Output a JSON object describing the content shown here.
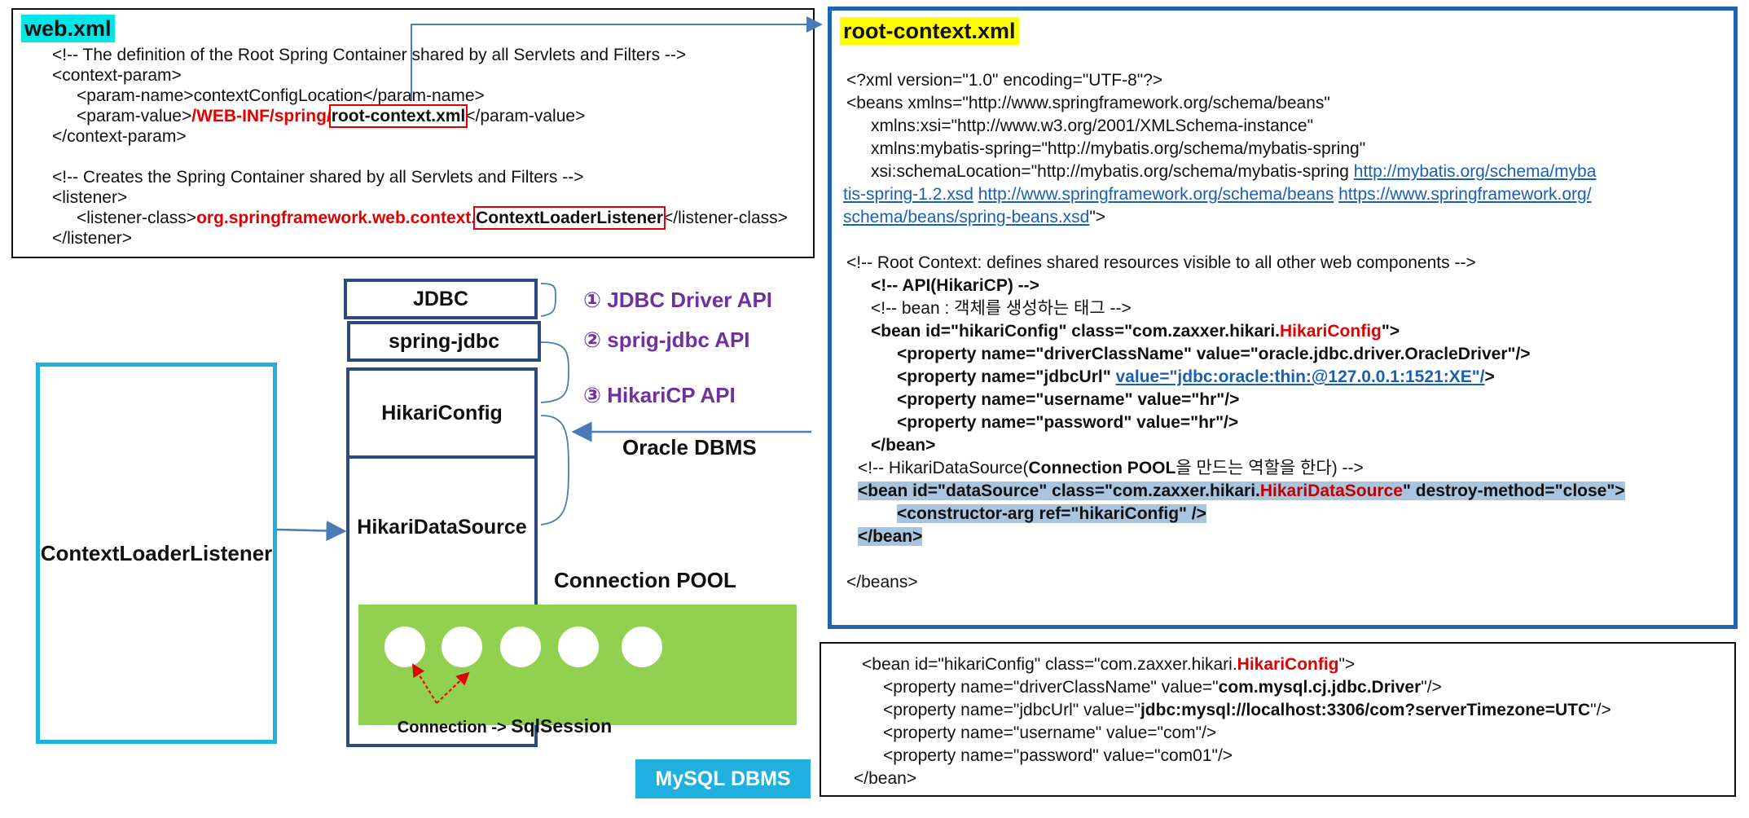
{
  "web_xml": {
    "title": "web.xml",
    "line1": "<!-- The definition of the Root Spring Container shared by all Servlets and Filters -->",
    "line2": "<context-param>",
    "line3a": "<param-name>",
    "line3b": "contextConfigLocation",
    "line3c": "</param-name>",
    "line4a": "<param-value>",
    "line4b": "/WEB-INF/spring/",
    "line4c": "root-context.xml",
    "line4d": "</param-value>",
    "line5": "</context-param>",
    "line6": "<!-- Creates the Spring Container shared by all Servlets and Filters -->",
    "line7": "<listener>",
    "line8a": "<listener-class>",
    "line8b": "org.springframework.web.context.",
    "line8c": "ContextLoaderListener",
    "line8d": "</listener-class>",
    "line9": "</listener>"
  },
  "root_context": {
    "title": "root-context.xml",
    "l1": "<?xml version=\"1.0\" encoding=\"UTF-8\"?>",
    "l2": "<beans xmlns=\"http://www.springframework.org/schema/beans\"",
    "l3": "xmlns:xsi=\"http://www.w3.org/2001/XMLSchema-instance\"",
    "l4": "xmlns:mybatis-spring=\"http://mybatis.org/schema/mybatis-spring\"",
    "l5a": "xsi:schemaLocation=\"http://mybatis.org/schema/mybatis-spring ",
    "l5b": "http://mybatis.org/schema/myba",
    "l6a": "tis-spring-1.2.xsd",
    "l6b": "http://www.springframework.org/schema/beans",
    "l6c": "https://www.springframework.org/",
    "l7a": "schema/beans/spring-beans.xsd",
    "l7b": "\">",
    "l8": "<!-- Root Context: defines shared resources visible to all other web components -->",
    "l9": "<!-- API(HikariCP) -->",
    "l10": "<!-- bean : 객체를 생성하는 태그 -->",
    "l11a": "<bean id=\"hikariConfig\" class=\"com.zaxxer.hikari.",
    "l11b": "HikariConfig",
    "l11c": "\">",
    "l12": "<property name=\"driverClassName\" value=\"oracle.jdbc.driver.OracleDriver\"/>",
    "l13a": "<property name=\"jdbcUrl\" ",
    "l13b": "value=\"jdbc:oracle:thin:@127.0.0.1:1521:XE\"/",
    "l13c": ">",
    "l14": "<property name=\"username\" value=\"hr\"/>",
    "l15": "<property name=\"password\" value=\"hr\"/>",
    "l16": "</bean>",
    "l17a": "<!-- HikariDataSource(",
    "l17b": "Connection POOL",
    "l17c": "을 만드는 역할을 한다) -->",
    "l18a": "<bean id=\"dataSource\" class=\"com.zaxxer.hikari.",
    "l18b": "HikariDataSource",
    "l18c": "\" destroy-method=\"close\">",
    "l19": "<constructor-arg ref=\"hikariConfig\" />",
    "l20": "</bean>",
    "l21": "</beans>"
  },
  "mysql_box": {
    "m1a": "<bean id=\"hikariConfig\" class=\"com.zaxxer.hikari.",
    "m1b": "HikariConfig",
    "m1c": "\">",
    "m2a": "<property name=\"driverClassName\" value=\"",
    "m2b": "com.mysql.cj.jdbc.Driver",
    "m2c": "\"/>",
    "m3a": "<property name=\"jdbcUrl\" value=\"",
    "m3b": "jdbc:mysql://localhost:3306/com?serverTimezone=UTC",
    "m3c": "\"/>",
    "m4": "<property name=\"username\" value=\"com\"/>",
    "m5": "<property name=\"password\" value=\"com01\"/>",
    "m6": "</bean>"
  },
  "diagram": {
    "listener_label": "ContextLoaderListener",
    "jdbc": "JDBC",
    "spring_jdbc": "spring-jdbc",
    "hikari_config": "HikariConfig",
    "hikari_datasource": "HikariDataSource",
    "api1": "① JDBC Driver API",
    "api2": "② sprig-jdbc API",
    "api3": "③ HikariCP API",
    "oracle_label": "Oracle DBMS",
    "pool_label": "Connection POOL",
    "conn_label_a": "Connection -> ",
    "conn_label_b": "SqlSession",
    "mysql_label": "MySQL DBMS"
  },
  "colors": {
    "web_title_bg": "#00e5e5",
    "root_title_bg": "#ffff00",
    "root_border": "#1f63b4",
    "listener_border": "#1fb0e0",
    "stack_border": "#2c4a7a",
    "pool_green": "#92d050",
    "api_purple": "#7030a0",
    "mysql_bg": "#1fb0e0"
  }
}
